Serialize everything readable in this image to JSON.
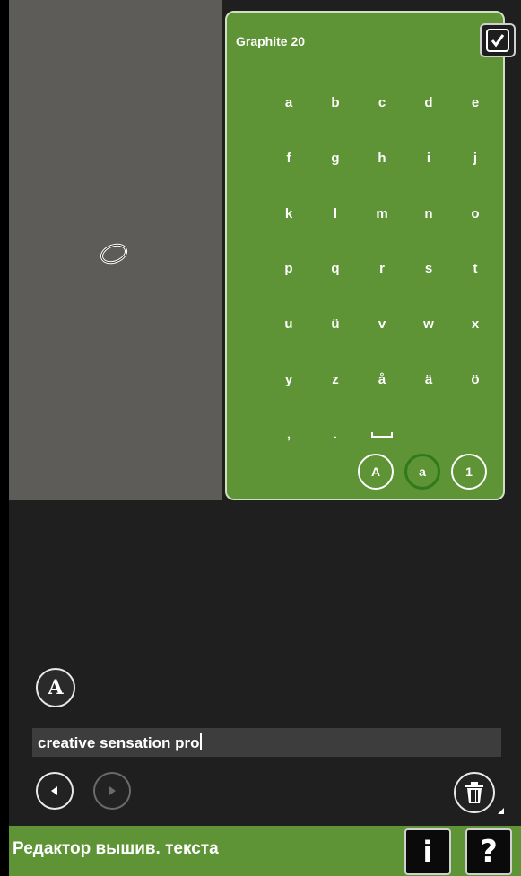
{
  "keyboard": {
    "font_name": "Graphite 20",
    "keys": [
      "a",
      "b",
      "c",
      "d",
      "e",
      "f",
      "g",
      "h",
      "i",
      "j",
      "k",
      "l",
      "m",
      "n",
      "o",
      "p",
      "q",
      "r",
      "s",
      "t",
      "u",
      "ü",
      "v",
      "w",
      "x",
      "y",
      "z",
      "å",
      "ä",
      "ö",
      ",",
      ".",
      "space"
    ],
    "case_buttons": [
      "A",
      "a",
      "1"
    ],
    "active_case": "a"
  },
  "editor": {
    "font_button_label": "A",
    "text_value": "creative sensation pro"
  },
  "status_bar": {
    "title": "Редактор вышив. текста",
    "info_label": "i",
    "help_label": "?"
  },
  "colors": {
    "accent_green": "#5e9336",
    "canvas_gray": "#5d5c59",
    "background_dark": "#1f1f1f"
  }
}
